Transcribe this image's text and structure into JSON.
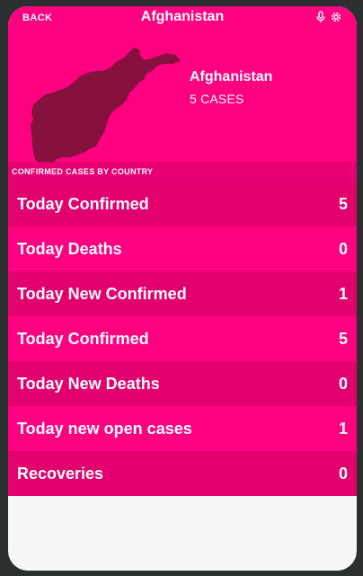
{
  "nav": {
    "back_label": "BACK",
    "title": "Afghanistan",
    "icons": [
      "microphone-icon",
      "gear-icon"
    ]
  },
  "country": {
    "name": "Afghanistan",
    "cases_text": "5 CASES"
  },
  "section": {
    "title": "CONFIRMED CASES BY COUNTRY"
  },
  "stats": [
    {
      "label": "Today Confirmed",
      "value": "5"
    },
    {
      "label": "Today Deaths",
      "value": "0"
    },
    {
      "label": "Today New Confirmed",
      "value": "1"
    },
    {
      "label": "Today Confirmed",
      "value": "5"
    },
    {
      "label": "Today New Deaths",
      "value": "0"
    },
    {
      "label": "Today new open cases",
      "value": "1"
    },
    {
      "label": "Recoveries",
      "value": "0"
    }
  ],
  "colors": {
    "primary": "#ff0080",
    "primary_dark": "#e2006f",
    "map_fill": "#86103e",
    "background": "#f6f7f8"
  }
}
